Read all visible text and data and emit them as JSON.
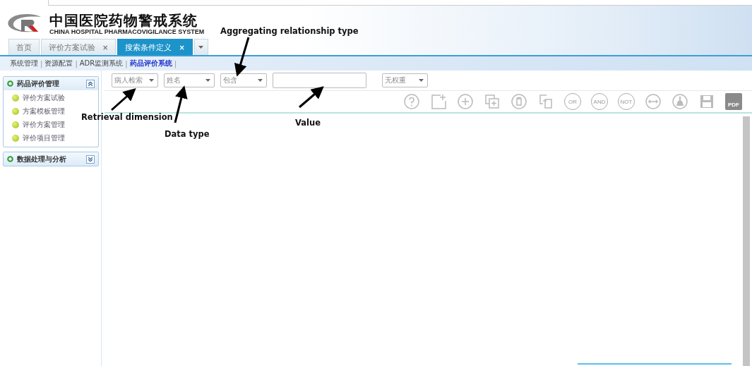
{
  "header": {
    "title": "中国医院药物警戒系统",
    "subtitle": "CHINA HOSPITAL PHARMACOVIGILANCE SYSTEM"
  },
  "tabs": [
    {
      "label": "首页",
      "selected": false
    },
    {
      "label": "评价方案试验",
      "close": "×",
      "selected": false
    },
    {
      "label": "搜索条件定义",
      "close": "×",
      "selected": true
    }
  ],
  "nav": [
    {
      "label": "系统管理",
      "separator": "|",
      "selected": false
    },
    {
      "label": "资源配置",
      "separator": "|",
      "selected": false
    },
    {
      "label": "ADR监测系统",
      "separator": "|",
      "selected": false
    },
    {
      "label": "药品评价系统",
      "separator": "|",
      "selected": true
    }
  ],
  "sidebar": [
    {
      "title": "药品评价管理",
      "expanded": true,
      "items": [
        "评价方案试验",
        "方案模板管理",
        "评价方案管理",
        "评价项目管理"
      ]
    },
    {
      "title": "数据处理与分析",
      "expanded": false
    }
  ],
  "filters": [
    {
      "kind": "select",
      "value": "病人检索"
    },
    {
      "kind": "select",
      "value": "姓名"
    },
    {
      "kind": "select",
      "value": "包含"
    },
    {
      "kind": "input"
    },
    {
      "kind": "select",
      "value": "无权重"
    }
  ],
  "toolbar": [
    {
      "kind": "help"
    },
    {
      "kind": "new"
    },
    {
      "kind": "add"
    },
    {
      "kind": "copy-add"
    },
    {
      "kind": "delete"
    },
    {
      "kind": "copy"
    },
    {
      "kind": "text",
      "label": "OR"
    },
    {
      "kind": "text",
      "label": "AND"
    },
    {
      "kind": "text",
      "label": "NOT"
    },
    {
      "kind": "swap"
    },
    {
      "kind": "clear"
    },
    {
      "kind": "save"
    },
    {
      "kind": "file",
      "label": "PDF"
    }
  ],
  "annotations": [
    {
      "text": "Aggregating relationship type"
    },
    {
      "text": "Retrieval dimension"
    },
    {
      "text": "Data type"
    },
    {
      "text": "Value"
    }
  ]
}
